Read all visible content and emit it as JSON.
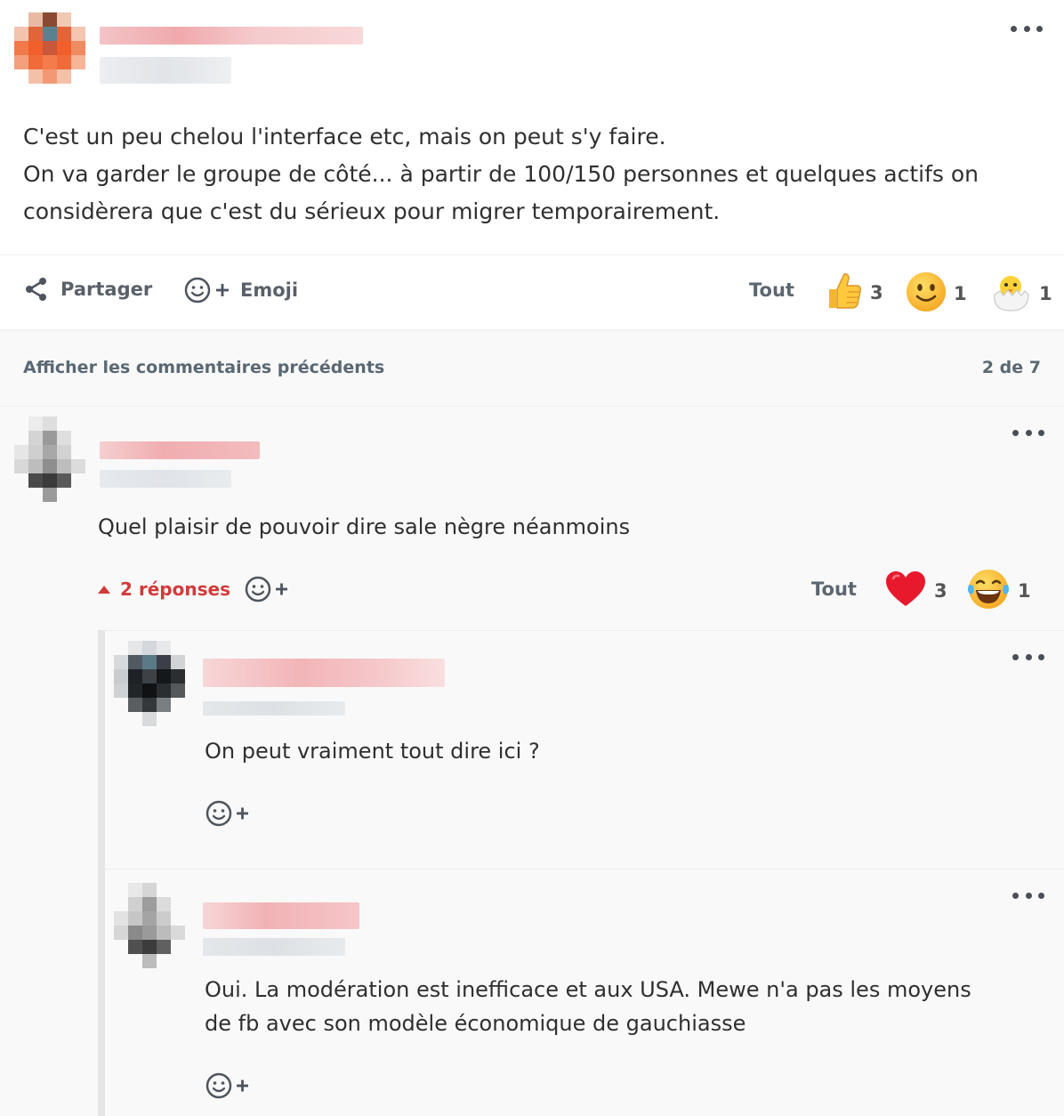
{
  "post": {
    "lines": [
      "C'est un peu chelou l'interface etc, mais on peut s'y faire.",
      "On va garder le groupe de côté... à partir de 100/150 personnes et quelques actifs on",
      "considèrera que c'est du sérieux pour migrer temporairement."
    ],
    "actions": {
      "share_label": "Partager",
      "emoji_label": "Emoji"
    },
    "reactions_all_label": "Tout",
    "reactions": [
      {
        "emoji": "thumbs-up",
        "count": "3"
      },
      {
        "emoji": "slightly-smiling-face",
        "count": "1"
      },
      {
        "emoji": "hatching-chick",
        "count": "1"
      }
    ]
  },
  "comments_header": {
    "show_previous_label": "Afficher les commentaires précédents",
    "pager": "2 de 7"
  },
  "comment": {
    "text": "Quel plaisir de pouvoir dire sale nègre néanmoins",
    "replies_label": "2 réponses",
    "reactions_all_label": "Tout",
    "reactions": [
      {
        "emoji": "red-heart",
        "count": "3"
      },
      {
        "emoji": "face-with-tears-of-joy",
        "count": "1"
      }
    ]
  },
  "replies": [
    {
      "lines": [
        "On peut vraiment tout dire ici ?"
      ]
    },
    {
      "lines": [
        "Oui. La modération est inefficace et aux USA. Mewe n'a pas les moyens",
        "de fb avec son modèle économique de gauchiasse"
      ]
    }
  ],
  "colors": {
    "accent_red": "#d23a3a",
    "text_grey": "#5a6874",
    "background_grey": "#f9f9f9"
  }
}
